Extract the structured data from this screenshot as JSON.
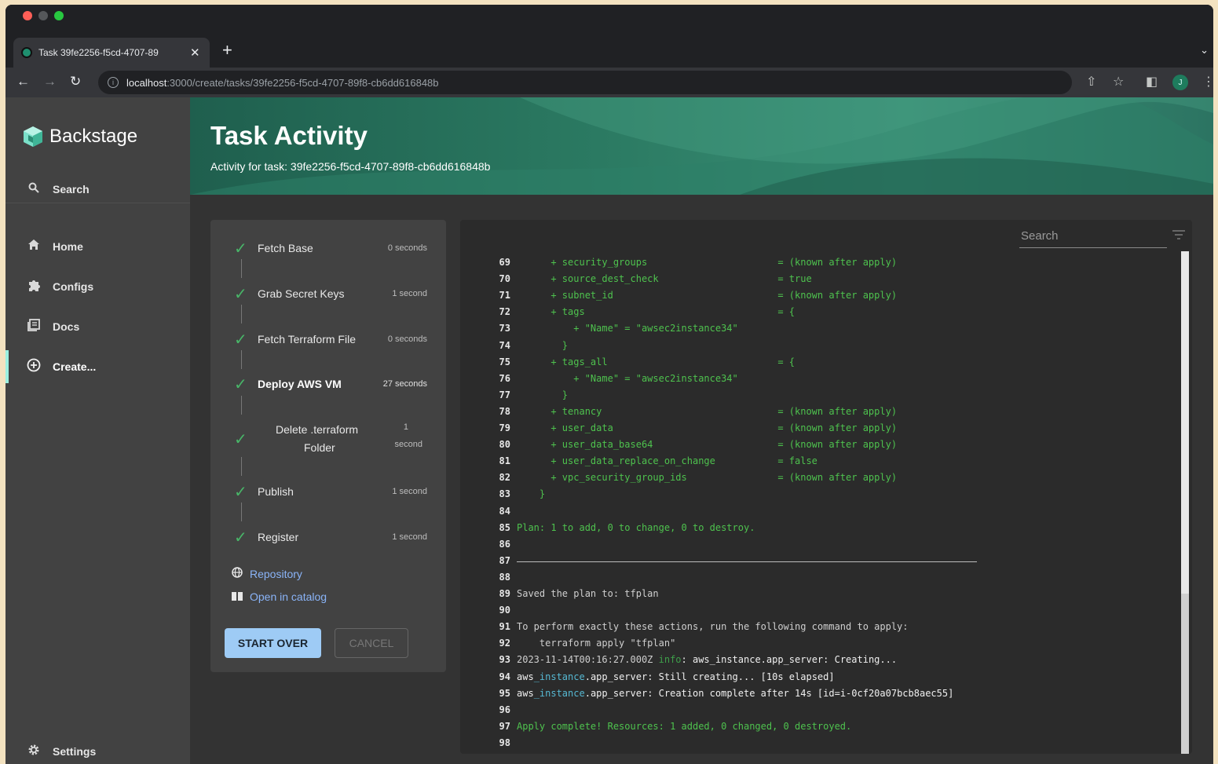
{
  "browser": {
    "tab_title": "Task 39fe2256-f5cd-4707-89",
    "url_host": "localhost",
    "url_path": ":3000/create/tasks/39fe2256-f5cd-4707-89f8-cb6dd616848b",
    "profile_initial": "J"
  },
  "sidebar": {
    "brand": "Backstage",
    "search": "Search",
    "items": [
      {
        "label": "Home",
        "icon": "home-icon"
      },
      {
        "label": "Configs",
        "icon": "puzzle-icon"
      },
      {
        "label": "Docs",
        "icon": "docs-icon"
      },
      {
        "label": "Create...",
        "icon": "plus-circle-icon"
      }
    ],
    "settings": "Settings"
  },
  "header": {
    "title": "Task Activity",
    "subtitle": "Activity for task: 39fe2256-f5cd-4707-89f8-cb6dd616848b"
  },
  "steps": [
    {
      "label": "Fetch Base",
      "time": "0 seconds"
    },
    {
      "label": "Grab Secret Keys",
      "time": "1 second"
    },
    {
      "label": "Fetch Terraform File",
      "time": "0 seconds"
    },
    {
      "label": "Deploy AWS VM",
      "time": "27 seconds"
    },
    {
      "label": "Delete .terraform Folder",
      "label_line1": "Delete .terraform",
      "label_line2": "Folder",
      "time": "1 second",
      "time_line1": "1",
      "time_line2": "second"
    },
    {
      "label": "Publish",
      "time": "1 second"
    },
    {
      "label": "Register",
      "time": "1 second"
    }
  ],
  "links": {
    "repository": "Repository",
    "open_in_catalog": "Open in catalog"
  },
  "buttons": {
    "start_over": "START OVER",
    "cancel": "CANCEL"
  },
  "log": {
    "search_placeholder": "Search",
    "lines": [
      {
        "n": "69",
        "segments": [
          {
            "t": "      + security_groups                       = (known after apply)",
            "c": "green"
          }
        ]
      },
      {
        "n": "70",
        "segments": [
          {
            "t": "      + source_dest_check                     = true",
            "c": "green"
          }
        ]
      },
      {
        "n": "71",
        "segments": [
          {
            "t": "      + subnet_id                             = (known after apply)",
            "c": "green"
          }
        ]
      },
      {
        "n": "72",
        "segments": [
          {
            "t": "      + tags                                  = {",
            "c": "green"
          }
        ]
      },
      {
        "n": "73",
        "segments": [
          {
            "t": "          + \"Name\" = \"awsec2instance34\"",
            "c": "green"
          }
        ]
      },
      {
        "n": "74",
        "segments": [
          {
            "t": "        }",
            "c": "green"
          }
        ]
      },
      {
        "n": "75",
        "segments": [
          {
            "t": "      + tags_all                              = {",
            "c": "green"
          }
        ]
      },
      {
        "n": "76",
        "segments": [
          {
            "t": "          + \"Name\" = \"awsec2instance34\"",
            "c": "green"
          }
        ]
      },
      {
        "n": "77",
        "segments": [
          {
            "t": "        }",
            "c": "green"
          }
        ]
      },
      {
        "n": "78",
        "segments": [
          {
            "t": "      + tenancy                               = (known after apply)",
            "c": "green"
          }
        ]
      },
      {
        "n": "79",
        "segments": [
          {
            "t": "      + user_data                             = (known after apply)",
            "c": "green"
          }
        ]
      },
      {
        "n": "80",
        "segments": [
          {
            "t": "      + user_data_base64                      = (known after apply)",
            "c": "green"
          }
        ]
      },
      {
        "n": "81",
        "segments": [
          {
            "t": "      + user_data_replace_on_change           = false",
            "c": "green"
          }
        ]
      },
      {
        "n": "82",
        "segments": [
          {
            "t": "      + vpc_security_group_ids                = (known after apply)",
            "c": "green"
          }
        ]
      },
      {
        "n": "83",
        "segments": [
          {
            "t": "    }",
            "c": "green"
          }
        ]
      },
      {
        "n": "84",
        "segments": []
      },
      {
        "n": "85",
        "segments": [
          {
            "t": "Plan: 1 to add, 0 to change, 0 to destroy.",
            "c": "green"
          }
        ]
      },
      {
        "n": "86",
        "segments": []
      },
      {
        "n": "87",
        "segments": []
      },
      {
        "n": "88",
        "segments": []
      },
      {
        "n": "89",
        "segments": [
          {
            "t": "Saved the plan to: tfplan",
            "c": "gray"
          }
        ]
      },
      {
        "n": "90",
        "segments": []
      },
      {
        "n": "91",
        "segments": [
          {
            "t": "To perform exactly these actions, run the following command to apply:",
            "c": "gray"
          }
        ]
      },
      {
        "n": "92",
        "segments": [
          {
            "t": "    terraform apply \"tfplan\"",
            "c": "gray"
          }
        ]
      },
      {
        "n": "93",
        "segments": [
          {
            "t": "2023-11-14T00:16:27.000Z ",
            "c": "gray"
          },
          {
            "t": "info",
            "c": "dimgreen"
          },
          {
            "t": ": ",
            "c": "white"
          },
          {
            "t": "aws_instance.app_server",
            "c": "white"
          },
          {
            "t": ": Creating...",
            "c": "white"
          }
        ]
      },
      {
        "n": "94",
        "segments": [
          {
            "t": "aws",
            "c": "white"
          },
          {
            "t": "_instance",
            "c": "cyan"
          },
          {
            "t": ".app_server: Still creating... [10s elapsed]",
            "c": "white"
          }
        ]
      },
      {
        "n": "95",
        "segments": [
          {
            "t": "aws",
            "c": "white"
          },
          {
            "t": "_instance",
            "c": "cyan"
          },
          {
            "t": ".app_server: Creation complete after 14s [id=i-0cf20a07bcb8aec55]",
            "c": "white"
          }
        ]
      },
      {
        "n": "96",
        "segments": []
      },
      {
        "n": "97",
        "segments": [
          {
            "t": "Apply complete! Resources: 1 added, 0 changed, 0 destroyed.",
            "c": "green"
          }
        ]
      },
      {
        "n": "98",
        "segments": []
      }
    ]
  },
  "colors": {
    "accent": "#9ecbf5",
    "success": "#48b568",
    "header_start": "#1f5f4e",
    "header_end": "#3a8f76"
  }
}
